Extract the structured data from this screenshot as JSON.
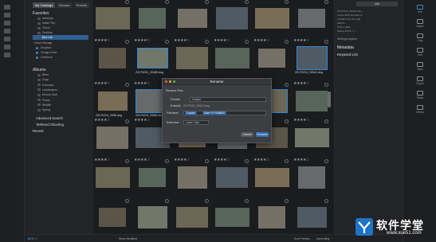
{
  "left_panel": {
    "tabs": [
      "My Catalogs",
      "Browse",
      "Presets"
    ],
    "favorites_title": "Favorites",
    "favorites": [
      "Antelope",
      "Safari Trip",
      "Travel"
    ],
    "collections": [
      "Desktop",
      "Birds",
      "Skyline"
    ],
    "selected_folder": "Bird Life",
    "cloud_title": "Cloud Storage",
    "cloud_items": [
      "Dropbox",
      "Google Drive",
      "OneDrive"
    ],
    "albums_title": "Albums",
    "albums": [
      "Birds",
      "Dogs",
      "Favorites",
      "Landscapes",
      "Moody Stuff",
      "Plants",
      "Wildlife",
      "Spring"
    ],
    "advanced_search": "Advanced Search",
    "tethered": "Tethered Shooting",
    "recent": "Recent"
  },
  "grid": {
    "filenames": {
      "r2c2": "20170224_20485.dng",
      "r2c5": "20170224_20541.dng",
      "r3c0": "20170224_2056.dng",
      "r3c1": "20170224_20591.dng"
    }
  },
  "dialog": {
    "title": "Rename",
    "section": "Rename Files",
    "preset_label": "Presets",
    "preset_value": "Custom",
    "example_label": "Example:",
    "example_value": "20170224_150512.dng",
    "filename_label": "Filename:",
    "token_a": "Caption",
    "token_b": "Date YYYYMMDD",
    "extension_label": "Extension:",
    "extension_value": "Lower Case",
    "cancel": "Cancel",
    "rename": "Rename"
  },
  "right_panel": {
    "search_value": "info",
    "info_lines": [
      "20170224_150512.dng",
      "Canon EOS 5D Mark IV",
      "1/1000s  f/5.6  ISO 400",
      "200mm",
      "6720 x 4480",
      "Rating ★★★☆☆"
    ],
    "settings_applied": "Settings Applied",
    "metadata": "Metadata",
    "keyword_list": "Keyword List"
  },
  "toolbar": {
    "items": [
      "Info",
      "Layers",
      "Crop",
      "Edit",
      "Sync",
      "Export",
      "Share",
      "Effects"
    ]
  },
  "bottom_bar": {
    "show_modified": "Show Modified",
    "sort_label": "Sort Preview",
    "sort_value": "Ascending"
  },
  "watermark": {
    "main": "软件学堂",
    "sub": "www.xue51.com"
  },
  "colors": {
    "selection": "#2f8ad8",
    "accent": "#3e86c9"
  }
}
